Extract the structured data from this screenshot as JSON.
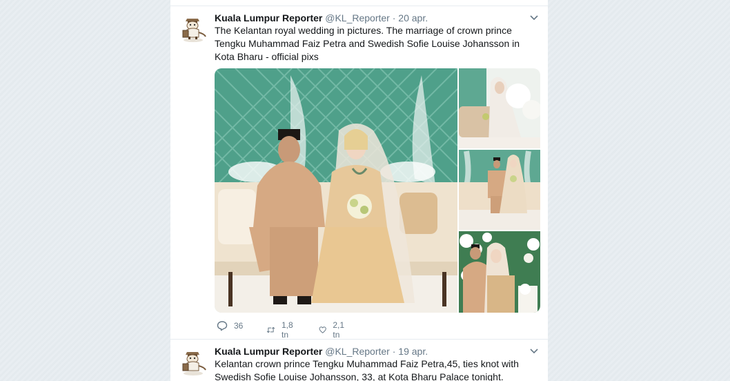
{
  "tweets": [
    {
      "author_name": "Kuala Lumpur Reporter",
      "handle": "@KL_Reporter",
      "separator": "·",
      "date": "20 apr.",
      "text": "The Kelantan royal wedding in pictures. The marriage of crown prince Tengku Muhammad Faiz Petra and Swedish Sofie Louise Johansson in Kota Bharu - official pixs",
      "replies": "36",
      "retweets": "1,8 tn",
      "likes": "2,1 tn"
    },
    {
      "author_name": "Kuala Lumpur Reporter",
      "handle": "@KL_Reporter",
      "separator": "·",
      "date": "19 apr.",
      "text": "Kelantan crown prince Tengku Muhammad Faiz Petra,45, ties knot with Swedish Sofie Louise Johansson, 33, at Kota Bharu Palace tonight."
    }
  ],
  "icons": {
    "reply": "reply-icon",
    "retweet": "retweet-icon",
    "like": "heart-icon",
    "more": "chevron-down-icon",
    "avatar": "cartoon-reporter-avatar"
  },
  "colors": {
    "text": "#14171a",
    "secondary": "#657786",
    "background": "#e6ecf0",
    "card": "#ffffff"
  }
}
